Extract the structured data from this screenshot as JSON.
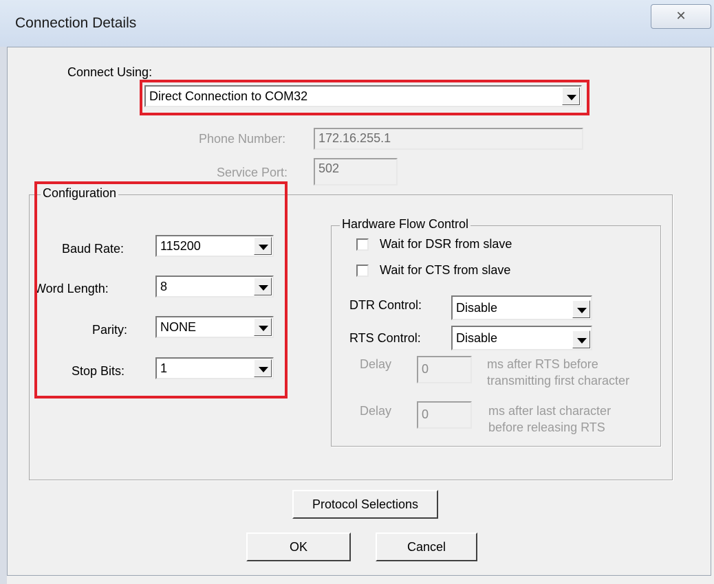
{
  "window": {
    "title": "Connection Details",
    "close_glyph": "✕"
  },
  "connect": {
    "label": "Connect Using:",
    "value": "Direct Connection to COM32",
    "phone_label": "Phone Number:",
    "phone_value": "172.16.255.1",
    "port_label": "Service Port:",
    "port_value": "502"
  },
  "configuration": {
    "title": "Configuration",
    "baud_label": "Baud Rate:",
    "baud_value": "115200",
    "word_label": "Word Length:",
    "word_value": "8",
    "parity_label": "Parity:",
    "parity_value": "NONE",
    "stop_label": "Stop Bits:",
    "stop_value": "1"
  },
  "flow": {
    "title": "Hardware Flow Control",
    "dsr_label": "Wait for DSR from slave",
    "cts_label": "Wait for CTS from slave",
    "dtr_label": "DTR Control:",
    "dtr_value": "Disable",
    "rts_label": "RTS Control:",
    "rts_value": "Disable",
    "delay1_label": "Delay",
    "delay1_value": "0",
    "delay1_note_1": "ms after RTS before",
    "delay1_note_2": "transmitting first character",
    "delay2_label": "Delay",
    "delay2_value": "0",
    "delay2_note_1": "ms after last character",
    "delay2_note_2": "before releasing RTS"
  },
  "buttons": {
    "protocol": "Protocol Selections",
    "ok": "OK",
    "cancel": "Cancel"
  },
  "colors": {
    "highlight": "#e2202a",
    "dialog_bg": "#f0f0f0"
  }
}
